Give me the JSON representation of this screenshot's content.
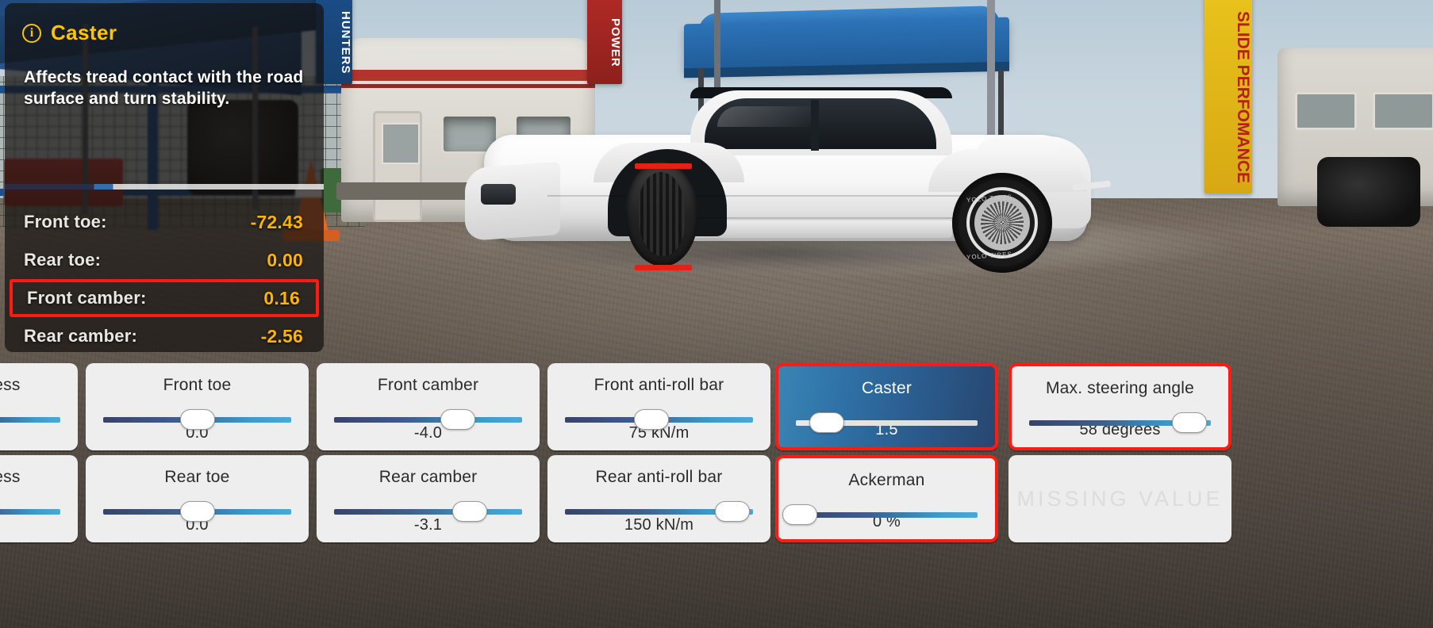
{
  "info_panel": {
    "icon": "info-circle-icon",
    "title": "Caster",
    "description": "Affects tread contact with the road surface and turn stability.",
    "title_color": "#ffc400",
    "value_color": "#ffb400",
    "highlight_color": "#ff1a14",
    "stats": [
      {
        "label": "Front toe:",
        "value": "-72.43",
        "highlighted": false
      },
      {
        "label": "Rear toe:",
        "value": "0.00",
        "highlighted": false
      },
      {
        "label": "Front camber:",
        "value": "0.16",
        "highlighted": true
      },
      {
        "label": "Rear camber:",
        "value": "-2.56",
        "highlighted": false
      }
    ]
  },
  "tuning_grid": {
    "row_top": [
      {
        "title": "ness",
        "value": "",
        "fill": 100,
        "clipped": true,
        "state": "normal"
      },
      {
        "title": "Front toe",
        "value": "0.0",
        "fill": 50,
        "clipped": false,
        "state": "normal"
      },
      {
        "title": "Front camber",
        "value": "-4.0",
        "fill": 66,
        "clipped": false,
        "state": "normal"
      },
      {
        "title": "Front anti-roll bar",
        "value": "75 kN/m",
        "fill": 46,
        "clipped": false,
        "state": "normal"
      },
      {
        "title": "Caster",
        "value": "1.5",
        "fill": 17,
        "clipped": false,
        "state": "selected"
      },
      {
        "title": "Max. steering angle",
        "value": "58 degrees",
        "fill": 88,
        "clipped": false,
        "state": "outlined"
      }
    ],
    "row_bottom": [
      {
        "title": "ness",
        "value": "",
        "fill": 100,
        "clipped": true,
        "state": "normal"
      },
      {
        "title": "Rear toe",
        "value": "0.0",
        "fill": 50,
        "clipped": false,
        "state": "normal"
      },
      {
        "title": "Rear camber",
        "value": "-3.1",
        "fill": 72,
        "clipped": false,
        "state": "normal"
      },
      {
        "title": "Rear anti-roll bar",
        "value": "150 kN/m",
        "fill": 89,
        "clipped": false,
        "state": "normal"
      },
      {
        "title": "Ackerman",
        "value": "0 %",
        "fill": 0,
        "clipped": false,
        "state": "outlined"
      },
      {
        "title": "MISSING VALUE",
        "value": "",
        "fill": null,
        "clipped": false,
        "state": "missing"
      }
    ]
  },
  "scene": {
    "banner_left": "HUNTERS",
    "banner_red": "POWER",
    "banner_yellow": "SLIDE PERFOMANCE",
    "tire_text": "YOLO TIRES"
  }
}
